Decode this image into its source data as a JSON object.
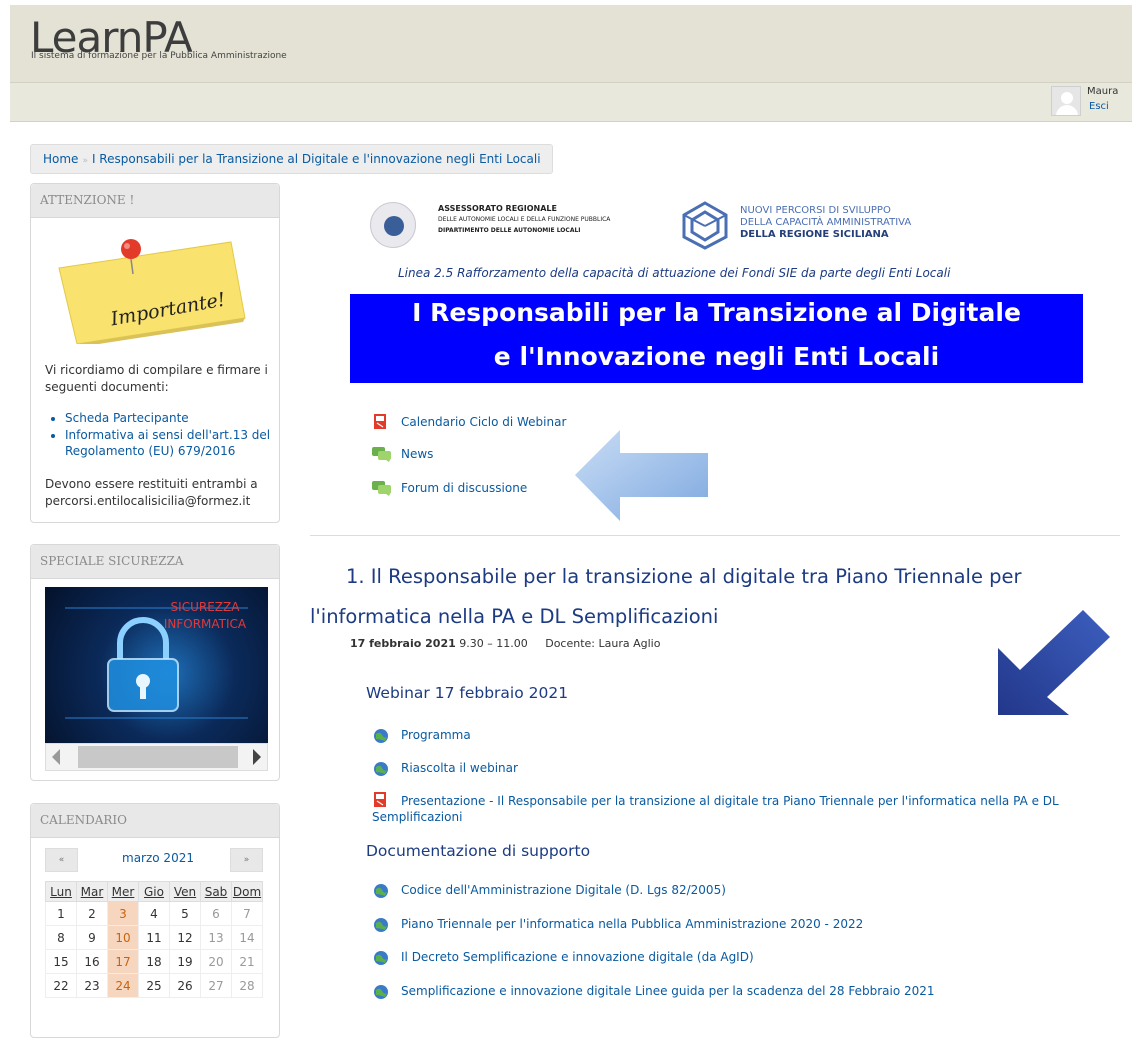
{
  "header": {
    "logo": "LearnPA",
    "tagline": "Il sistema di formazione per la Pubblica Amministrazione",
    "user_name": "Maura",
    "logout": "Esci"
  },
  "breadcrumb": {
    "home": "Home",
    "separator": "»",
    "current": "I Responsabili per la Transizione al Digitale e l'innovazione negli Enti Locali"
  },
  "attention_block": {
    "title": "ATTENZIONE !",
    "note_text": "Importante!",
    "intro": "Vi ricordiamo di compilare e firmare i seguenti documenti:",
    "links": [
      "Scheda Partecipante",
      "Informativa ai sensi dell'art.13 del Regolamento (EU) 679/2016"
    ],
    "footer": "Devono essere restituiti entrambi a percorsi.entilocalisicilia@formez.it"
  },
  "security_block": {
    "title": "SPECIALE SICUREZZA",
    "image_text_1": "SICUREZZA",
    "image_text_2": "INFORMATICA"
  },
  "calendar": {
    "title": "CALENDARIO",
    "prev": "«",
    "next": "»",
    "month": "marzo 2021",
    "weekdays": [
      "Lun",
      "Mar",
      "Mer",
      "Gio",
      "Ven",
      "Sab",
      "Dom"
    ],
    "weeks": [
      [
        "1",
        "2",
        "3",
        "4",
        "5",
        "6",
        "7"
      ],
      [
        "8",
        "9",
        "10",
        "11",
        "12",
        "13",
        "14"
      ],
      [
        "15",
        "16",
        "17",
        "18",
        "19",
        "20",
        "21"
      ],
      [
        "22",
        "23",
        "24",
        "25",
        "26",
        "27",
        "28"
      ]
    ],
    "event_days": [
      "3",
      "10",
      "17",
      "24"
    ]
  },
  "banner": {
    "org1_line1": "ASSESSORATO REGIONALE",
    "org1_line2": "DELLE AUTONOMIE LOCALI E DELLA FUNZIONE PUBBLICA",
    "org1_line3": "DIPARTIMENTO DELLE AUTONOMIE LOCALI",
    "org2_line1": "NUOVI PERCORSI DI SVILUPPO",
    "org2_line2": "DELLA CAPACITÀ AMMINISTRATIVA",
    "org2_line3": "DELLA REGIONE SICILIANA",
    "linea": "Linea 2.5 Rafforzamento della capacità di attuazione dei Fondi SIE da parte degli Enti Locali",
    "title_line1": "I Responsabili per la Transizione al Digitale",
    "title_line2": "e l'Innovazione negli Enti Locali"
  },
  "top_links": {
    "calendario": "Calendario Ciclo di Webinar",
    "news": "News",
    "forum": "Forum di discussione"
  },
  "section1": {
    "title": "1. Il Responsabile per la transizione al digitale tra Piano Triennale per l'informatica nella PA e DL Semplificazioni",
    "date_bold": "17 febbraio 2021",
    "time": "9.30 – 11.00",
    "docente": "Docente: Laura Aglio",
    "webinar_heading": "Webinar 17 febbraio 2021",
    "programma": "Programma",
    "riascolta": "Riascolta il webinar",
    "presentazione": "Presentazione - Il Responsabile per la transizione al digitale tra Piano Triennale per l'informatica nella PA e DL Semplificazioni",
    "doc_heading": "Documentazione di supporto",
    "docs": [
      "Codice dell'Amministrazione Digitale (D. Lgs 82/2005)",
      "Piano Triennale per l'informatica nella Pubblica Amministrazione 2020 - 2022",
      "Il Decreto Semplificazione e innovazione digitale (da AgID)",
      "Semplificazione e innovazione digitale Linee guida per la scadenza del 28 Febbraio 2021"
    ]
  },
  "colors": {
    "link": "#0a5aa0",
    "heading": "#1c3b82",
    "banner_blue": "#0000ff",
    "arrow_light": "#9cc0ea",
    "arrow_dark": "#2c4aa0",
    "event_day": "#f7d6bf"
  },
  "icons": {
    "pdf": "pdf-icon",
    "forum": "forum-icon",
    "url": "globe-link-icon"
  }
}
